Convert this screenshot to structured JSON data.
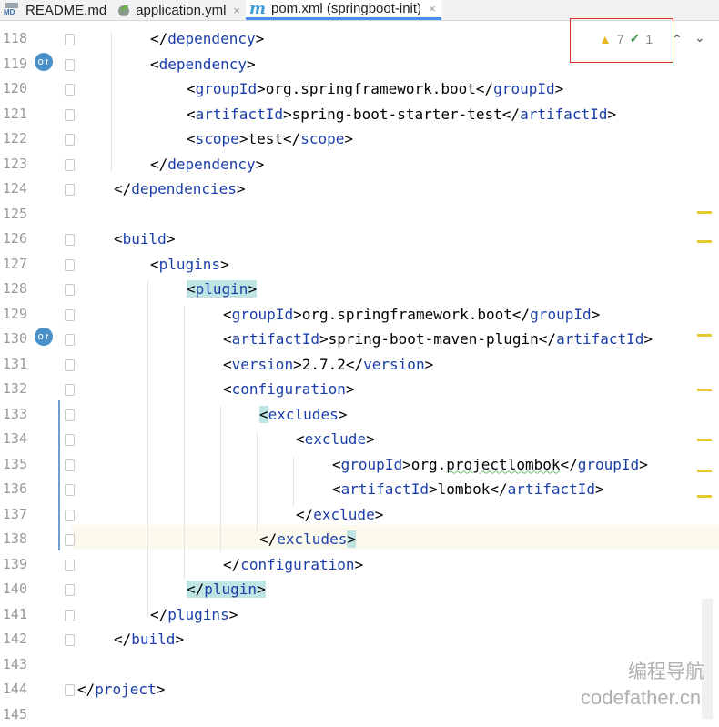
{
  "tabs": [
    {
      "label": "README.md",
      "icon": "markdown-file-icon",
      "active": false
    },
    {
      "label": "application.yml",
      "icon": "yaml-file-icon",
      "active": false
    },
    {
      "label": "pom.xml (springboot-init)",
      "icon": "maven-file-icon",
      "active": true
    }
  ],
  "close_glyph": "×",
  "md_icon_label": "MD",
  "maven_icon_glyph": "m",
  "inspections": {
    "warnings": "7",
    "weak_warnings": "1"
  },
  "code_lines": [
    {
      "num": "118",
      "tokens": [
        {
          "t": "</",
          "c": "br"
        },
        {
          "t": "dependency",
          "c": "tag"
        },
        {
          "t": ">",
          "c": "br"
        }
      ]
    },
    {
      "num": "119",
      "tokens": [
        {
          "t": "<",
          "c": "br"
        },
        {
          "t": "dependency",
          "c": "tag"
        },
        {
          "t": ">",
          "c": "br"
        }
      ]
    },
    {
      "num": "120",
      "tokens": [
        {
          "t": "<",
          "c": "br"
        },
        {
          "t": "groupId",
          "c": "tag"
        },
        {
          "t": ">org.springframework.boot</",
          "c": "br"
        },
        {
          "t": "groupId",
          "c": "tag"
        },
        {
          "t": ">",
          "c": "br"
        }
      ]
    },
    {
      "num": "121",
      "tokens": [
        {
          "t": "<",
          "c": "br"
        },
        {
          "t": "artifactId",
          "c": "tag"
        },
        {
          "t": ">spring-boot-starter-test</",
          "c": "br"
        },
        {
          "t": "artifactId",
          "c": "tag"
        },
        {
          "t": ">",
          "c": "br"
        }
      ]
    },
    {
      "num": "122",
      "tokens": [
        {
          "t": "<",
          "c": "br"
        },
        {
          "t": "scope",
          "c": "tag"
        },
        {
          "t": ">test</",
          "c": "br"
        },
        {
          "t": "scope",
          "c": "tag"
        },
        {
          "t": ">",
          "c": "br"
        }
      ]
    },
    {
      "num": "123",
      "tokens": [
        {
          "t": "</",
          "c": "br"
        },
        {
          "t": "dependency",
          "c": "tag"
        },
        {
          "t": ">",
          "c": "br"
        }
      ]
    },
    {
      "num": "124",
      "tokens": [
        {
          "t": "</",
          "c": "br"
        },
        {
          "t": "dependencies",
          "c": "tag"
        },
        {
          "t": ">",
          "c": "br"
        }
      ]
    },
    {
      "num": "125",
      "tokens": []
    },
    {
      "num": "126",
      "tokens": [
        {
          "t": "<",
          "c": "br"
        },
        {
          "t": "build",
          "c": "tag"
        },
        {
          "t": ">",
          "c": "br"
        }
      ]
    },
    {
      "num": "127",
      "tokens": [
        {
          "t": "<",
          "c": "br"
        },
        {
          "t": "plugins",
          "c": "tag"
        },
        {
          "t": ">",
          "c": "br"
        }
      ]
    },
    {
      "num": "128",
      "tokens": [
        {
          "t": "<",
          "c": "br hl"
        },
        {
          "t": "plugin",
          "c": "tag hl"
        },
        {
          "t": ">",
          "c": "br hl"
        }
      ]
    },
    {
      "num": "129",
      "tokens": [
        {
          "t": "<",
          "c": "br"
        },
        {
          "t": "groupId",
          "c": "tag"
        },
        {
          "t": ">org.springframework.boot</",
          "c": "br"
        },
        {
          "t": "groupId",
          "c": "tag"
        },
        {
          "t": ">",
          "c": "br"
        }
      ]
    },
    {
      "num": "130",
      "tokens": [
        {
          "t": "<",
          "c": "br"
        },
        {
          "t": "artifactId",
          "c": "tag"
        },
        {
          "t": ">spring-boot-maven-plugin</",
          "c": "br"
        },
        {
          "t": "artifactId",
          "c": "tag"
        },
        {
          "t": ">",
          "c": "br"
        }
      ]
    },
    {
      "num": "131",
      "tokens": [
        {
          "t": "<",
          "c": "br"
        },
        {
          "t": "version",
          "c": "tag"
        },
        {
          "t": ">2.7.2</",
          "c": "br"
        },
        {
          "t": "version",
          "c": "tag"
        },
        {
          "t": ">",
          "c": "br"
        }
      ]
    },
    {
      "num": "132",
      "tokens": [
        {
          "t": "<",
          "c": "br"
        },
        {
          "t": "configuration",
          "c": "tag"
        },
        {
          "t": ">",
          "c": "br"
        }
      ]
    },
    {
      "num": "133",
      "tokens": [
        {
          "t": "<",
          "c": "br hl"
        },
        {
          "t": "excludes",
          "c": "tag"
        },
        {
          "t": ">",
          "c": "br"
        }
      ]
    },
    {
      "num": "134",
      "tokens": [
        {
          "t": "<",
          "c": "br"
        },
        {
          "t": "exclude",
          "c": "tag"
        },
        {
          "t": ">",
          "c": "br"
        }
      ]
    },
    {
      "num": "135",
      "tokens": [
        {
          "t": "<",
          "c": "br"
        },
        {
          "t": "groupId",
          "c": "tag"
        },
        {
          "t": ">org.",
          "c": "br"
        },
        {
          "t": "projectlombok",
          "c": "br squiggle"
        },
        {
          "t": "</",
          "c": "br"
        },
        {
          "t": "groupId",
          "c": "tag"
        },
        {
          "t": ">",
          "c": "br"
        }
      ]
    },
    {
      "num": "136",
      "tokens": [
        {
          "t": "<",
          "c": "br"
        },
        {
          "t": "artifactId",
          "c": "tag"
        },
        {
          "t": ">lombok</",
          "c": "br"
        },
        {
          "t": "artifactId",
          "c": "tag"
        },
        {
          "t": ">",
          "c": "br"
        }
      ]
    },
    {
      "num": "137",
      "tokens": [
        {
          "t": "</",
          "c": "br"
        },
        {
          "t": "exclude",
          "c": "tag"
        },
        {
          "t": ">",
          "c": "br"
        }
      ]
    },
    {
      "num": "138",
      "tokens": [
        {
          "t": "</",
          "c": "br"
        },
        {
          "t": "excludes",
          "c": "tag"
        },
        {
          "t": ">",
          "c": "br hl"
        }
      ]
    },
    {
      "num": "139",
      "tokens": [
        {
          "t": "</",
          "c": "br"
        },
        {
          "t": "configuration",
          "c": "tag"
        },
        {
          "t": ">",
          "c": "br"
        }
      ]
    },
    {
      "num": "140",
      "tokens": [
        {
          "t": "</",
          "c": "br hl"
        },
        {
          "t": "plugin",
          "c": "tag hl"
        },
        {
          "t": ">",
          "c": "br hl"
        }
      ]
    },
    {
      "num": "141",
      "tokens": [
        {
          "t": "</",
          "c": "br"
        },
        {
          "t": "plugins",
          "c": "tag"
        },
        {
          "t": ">",
          "c": "br"
        }
      ]
    },
    {
      "num": "142",
      "tokens": [
        {
          "t": "</",
          "c": "br"
        },
        {
          "t": "build",
          "c": "tag"
        },
        {
          "t": ">",
          "c": "br"
        }
      ]
    },
    {
      "num": "143",
      "tokens": []
    },
    {
      "num": "144",
      "tokens": [
        {
          "t": "</",
          "c": "br"
        },
        {
          "t": "project",
          "c": "tag"
        },
        {
          "t": ">",
          "c": "br"
        }
      ]
    },
    {
      "num": "145",
      "tokens": []
    }
  ],
  "watermark": {
    "line1": "编程导航",
    "line2": "codefather.cn"
  },
  "colors": {
    "tag": "#1a3ea8",
    "highlight": "#bfe4e4",
    "warning": "#e8b72a",
    "current_line": "#fcfaed"
  }
}
